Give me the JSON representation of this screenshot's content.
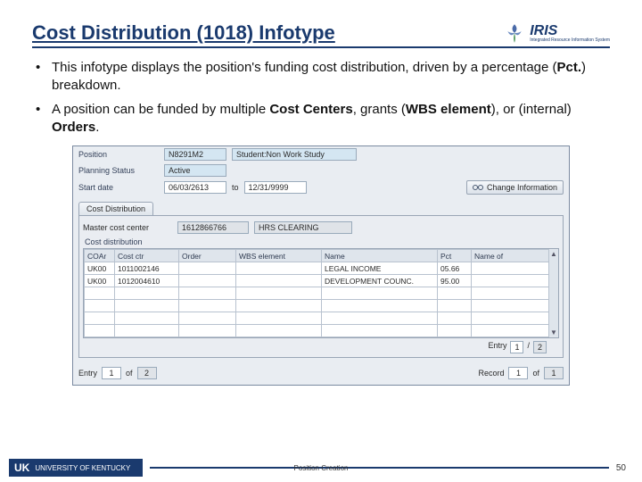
{
  "title": "Cost Distribution (1018) Infotype",
  "logo": {
    "name": "IRIS",
    "sub": "Integrated Resource Information System"
  },
  "bullets": [
    {
      "pre": "This infotype displays the position's funding cost distribution, driven by a percentage (",
      "b1": "Pct.",
      "mid1": ") breakdown."
    },
    {
      "pre": "A position can be funded by multiple ",
      "b1": "Cost Centers",
      "mid1": ", grants (",
      "b2": "WBS element",
      "mid2": "), or (internal) ",
      "b3": "Orders",
      "mid3": "."
    }
  ],
  "sap": {
    "position_label": "Position",
    "position_code": "N8291M2",
    "position_text": "Student:Non Work Study",
    "planning_status_label": "Planning Status",
    "planning_status": "Active",
    "start_date_label": "Start date",
    "start_date": "06/03/2613",
    "to_label": "to",
    "end_date": "12/31/9999",
    "change_btn": "Change Information",
    "tab": "Cost Distribution",
    "master_cc_label": "Master cost center",
    "master_cc_code": "1612866766",
    "master_cc_name": "HRS CLEARING",
    "group": "Cost distribution",
    "columns": {
      "coar": "COAr",
      "cost_ctr": "Cost ctr",
      "order": "Order",
      "wbs": "WBS element",
      "name": "Name",
      "pct": "Pct",
      "name_of": "Name of"
    },
    "rows": [
      {
        "coar": "UK00",
        "cost_ctr": "1011002146",
        "order": "",
        "wbs": "",
        "name": "LEGAL INCOME",
        "pct": "05.66",
        "name_of": ""
      },
      {
        "coar": "UK00",
        "cost_ctr": "1012004610",
        "order": "",
        "wbs": "",
        "name": "DEVELOPMENT COUNC.",
        "pct": "95.00",
        "name_of": ""
      }
    ],
    "entry_top": {
      "label": "Entry",
      "cur": "1",
      "sep": "/",
      "tot": "2"
    },
    "entry_label": "Entry",
    "entry_cur": "1",
    "entry_of": "of",
    "entry_tot": "2",
    "record_label": "Record",
    "record_cur": "1",
    "record_of": "of",
    "record_tot": "1"
  },
  "footer": {
    "uk": "UK",
    "univ": "UNIVERSITY OF KENTUCKY",
    "center": "Position Creation",
    "page": "50"
  }
}
